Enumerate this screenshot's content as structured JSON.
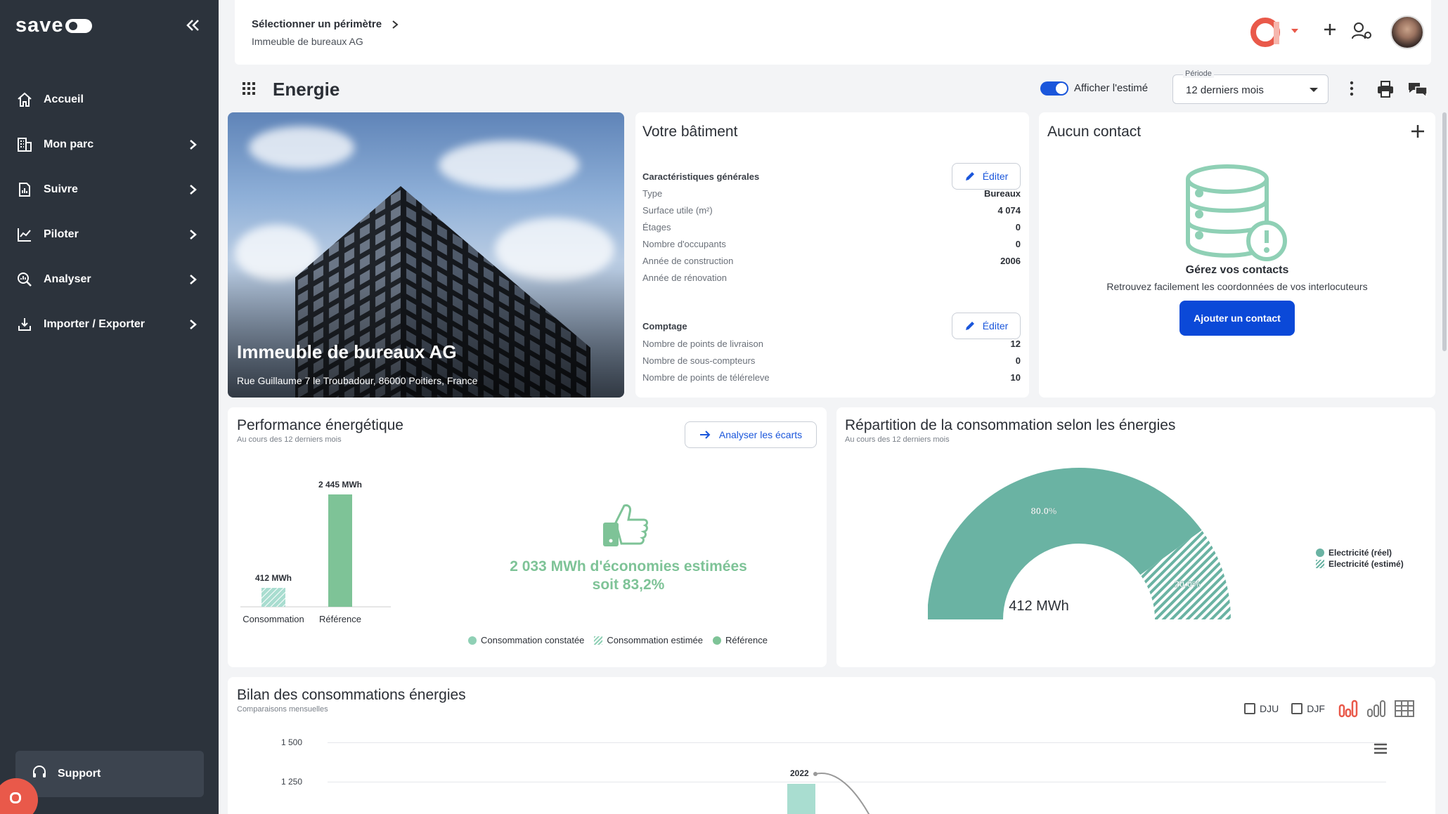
{
  "sidebar": {
    "logo_text": "save",
    "items": [
      {
        "label": "Accueil",
        "icon": "home-icon"
      },
      {
        "label": "Mon parc",
        "icon": "buildings-icon"
      },
      {
        "label": "Suivre",
        "icon": "report-icon"
      },
      {
        "label": "Piloter",
        "icon": "trend-chart-icon"
      },
      {
        "label": "Analyser",
        "icon": "search-analytics-icon"
      },
      {
        "label": "Importer / Exporter",
        "icon": "import-export-icon"
      }
    ],
    "support_label": "Support"
  },
  "topbar": {
    "perimeter_title": "Sélectionner un périmètre",
    "perimeter_value": "Immeuble de bureaux AG"
  },
  "page": {
    "title": "Energie",
    "toggle_label": "Afficher l'estimé",
    "toggle_on": true,
    "period_legend": "Période",
    "period_value": "12 derniers mois"
  },
  "hero": {
    "name": "Immeuble de bureaux AG",
    "address": "Rue Guillaume 7 le Troubadour, 86000 Poitiers, France"
  },
  "building": {
    "title": "Votre bâtiment",
    "general_title": "Caractéristiques générales",
    "edit_label": "Éditer",
    "general": [
      {
        "k": "Type",
        "v": "Bureaux"
      },
      {
        "k": "Surface utile (m²)",
        "v": "4 074"
      },
      {
        "k": "Étages",
        "v": "0"
      },
      {
        "k": "Nombre d'occupants",
        "v": "0"
      },
      {
        "k": "Année de construction",
        "v": "2006"
      },
      {
        "k": "Année de rénovation",
        "v": ""
      }
    ],
    "counting_title": "Comptage",
    "counting": [
      {
        "k": "Nombre de points de livraison",
        "v": "12"
      },
      {
        "k": "Nombre de sous-compteurs",
        "v": "0"
      },
      {
        "k": "Nombre de points de téléreleve",
        "v": "10"
      }
    ]
  },
  "contact": {
    "title": "Aucun contact",
    "heading": "Gérez vos contacts",
    "description": "Retrouvez facilement les coordonnées de vos interlocuteurs",
    "button": "Ajouter un contact"
  },
  "performance": {
    "title": "Performance énergétique",
    "subtitle": "Au cours des 12 derniers mois",
    "button": "Analyser les écarts",
    "saving_line1": "2 033 MWh d'économies estimées",
    "saving_line2": "soit 83,2%",
    "legend": [
      "Consommation constatée",
      "Consommation estimée",
      "Référence"
    ]
  },
  "repartition": {
    "title": "Répartition de la consommation selon les énergies",
    "subtitle": "Au cours des 12 derniers mois",
    "center_value": "412 MWh",
    "legend": [
      "Electricité (réel)",
      "Electricité (estimé)"
    ]
  },
  "bilan": {
    "title": "Bilan des consommations énergies",
    "subtitle": "Comparaisons mensuelles",
    "check_dju": "DJU",
    "check_djf": "DJF",
    "y_ticks": [
      "1 500",
      "1 250"
    ],
    "bar_label": "2022"
  },
  "colors": {
    "sidebar_bg": "#2c333c",
    "accent_blue": "#0b49d8",
    "green_bar": "#7ec397",
    "teal": "#6ab3a3",
    "brand_red": "#e9594a"
  },
  "chart_data": [
    {
      "type": "bar",
      "categories": [
        "Consommation",
        "Référence"
      ],
      "values": [
        412,
        2445
      ],
      "value_labels": [
        "412 MWh",
        "2 445 MWh"
      ],
      "unit": "MWh"
    },
    {
      "type": "pie",
      "labels": [
        "Electricité (réel)",
        "Electricité (estimé)"
      ],
      "values": [
        80.0,
        20.0
      ],
      "value_labels": [
        "80.0%",
        "20.0%"
      ],
      "total_label": "412 MWh",
      "style": "semi-donut"
    }
  ]
}
